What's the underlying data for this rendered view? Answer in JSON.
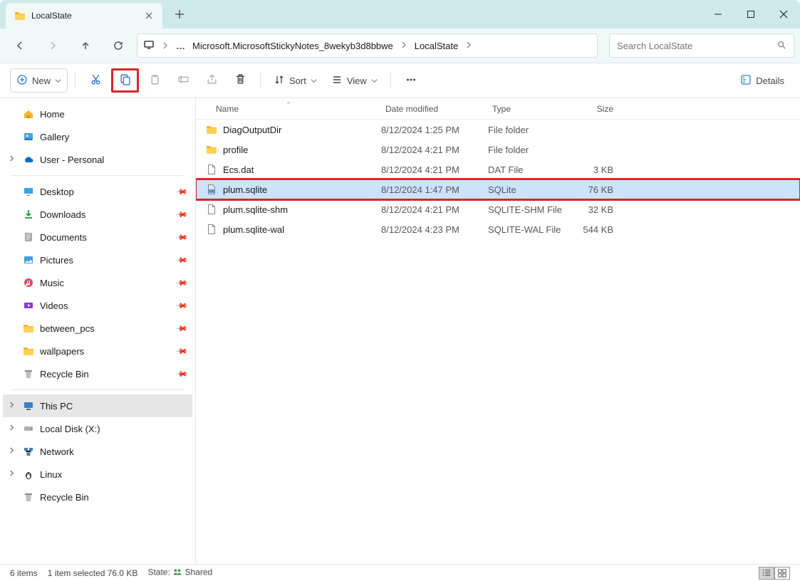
{
  "tab": {
    "title": "LocalState"
  },
  "breadcrumb": {
    "seg1": "Microsoft.MicrosoftStickyNotes_8wekyb3d8bbwe",
    "seg2": "LocalState"
  },
  "search": {
    "placeholder": "Search LocalState"
  },
  "toolbar": {
    "new": "New",
    "sort": "Sort",
    "view": "View",
    "details": "Details"
  },
  "nav": {
    "home": "Home",
    "gallery": "Gallery",
    "user": "User - Personal",
    "desktop": "Desktop",
    "downloads": "Downloads",
    "documents": "Documents",
    "pictures": "Pictures",
    "music": "Music",
    "videos": "Videos",
    "between_pcs": "between_pcs",
    "wallpapers": "wallpapers",
    "recycle": "Recycle Bin",
    "thispc": "This PC",
    "localdisk": "Local Disk (X:)",
    "network": "Network",
    "linux": "Linux",
    "recycle2": "Recycle Bin"
  },
  "cols": {
    "name": "Name",
    "date": "Date modified",
    "type": "Type",
    "size": "Size"
  },
  "files": {
    "r0": {
      "name": "DiagOutputDir",
      "date": "8/12/2024 1:25 PM",
      "type": "File folder",
      "size": ""
    },
    "r1": {
      "name": "profile",
      "date": "8/12/2024 4:21 PM",
      "type": "File folder",
      "size": ""
    },
    "r2": {
      "name": "Ecs.dat",
      "date": "8/12/2024 4:21 PM",
      "type": "DAT File",
      "size": "3 KB"
    },
    "r3": {
      "name": "plum.sqlite",
      "date": "8/12/2024 1:47 PM",
      "type": "SQLite",
      "size": "76 KB"
    },
    "r4": {
      "name": "plum.sqlite-shm",
      "date": "8/12/2024 4:21 PM",
      "type": "SQLITE-SHM File",
      "size": "32 KB"
    },
    "r5": {
      "name": "plum.sqlite-wal",
      "date": "8/12/2024 4:23 PM",
      "type": "SQLITE-WAL File",
      "size": "544 KB"
    }
  },
  "status": {
    "items": "6 items",
    "selected": "1 item selected  76.0 KB",
    "state_label": "State:",
    "shared": "Shared"
  }
}
